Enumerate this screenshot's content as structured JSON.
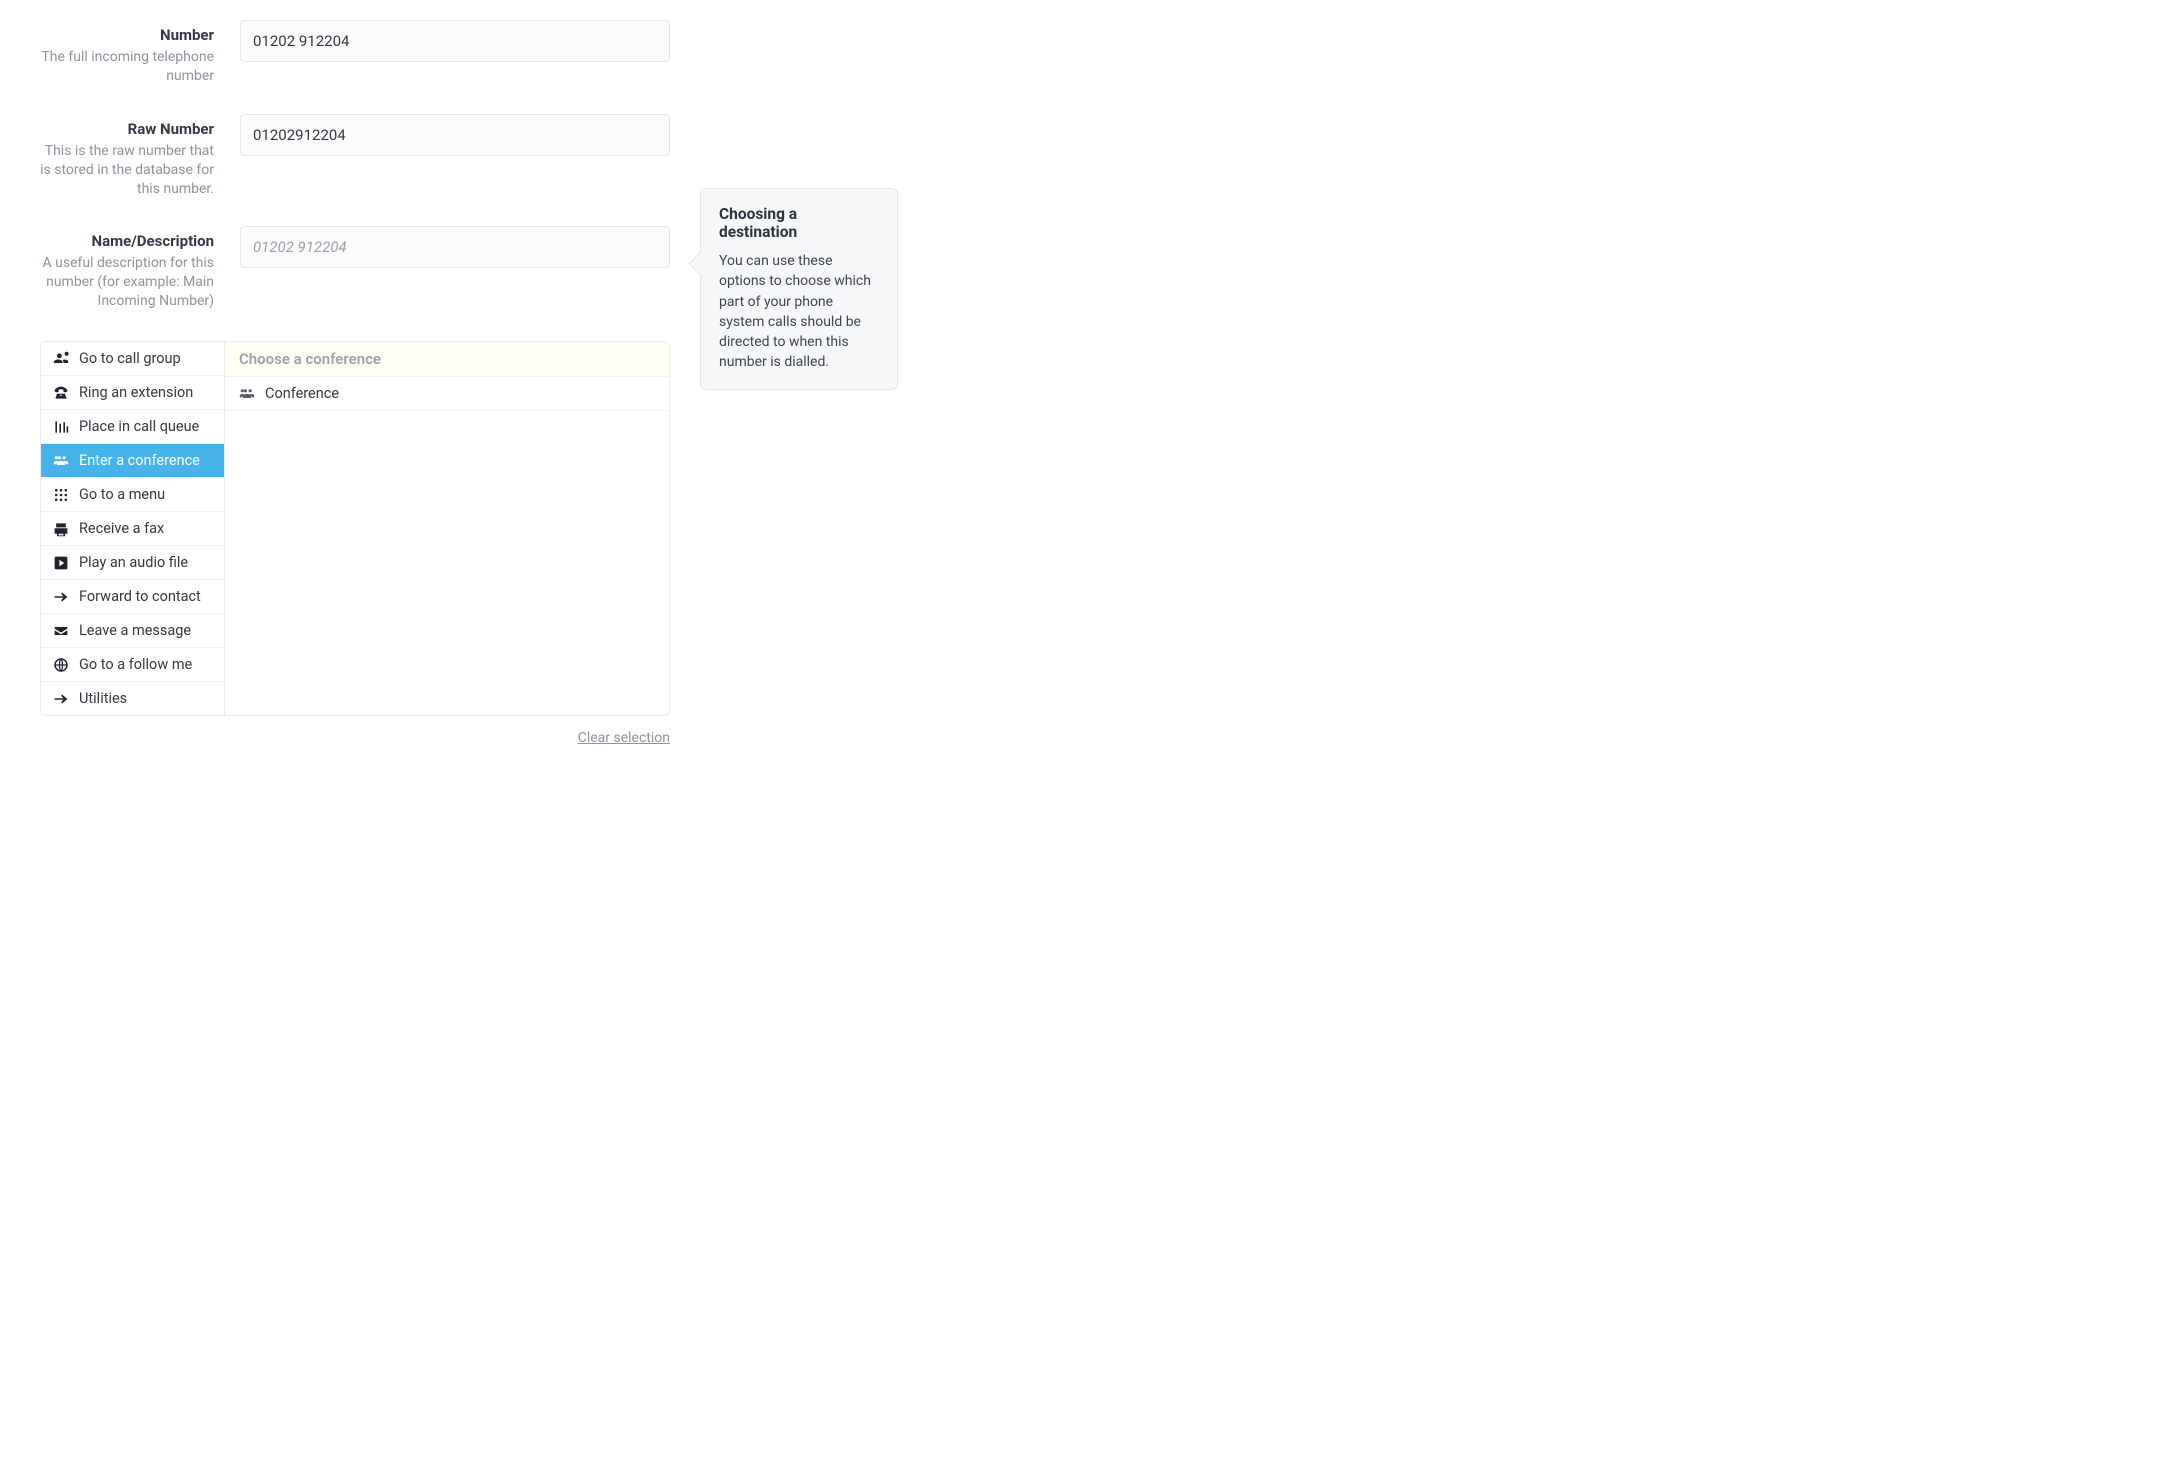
{
  "form": {
    "number": {
      "label": "Number",
      "hint": "The full incoming telephone number",
      "value": "01202 912204"
    },
    "raw_number": {
      "label": "Raw Number",
      "hint": "This is the raw number that is stored in the database for this number.",
      "value": "01202912204"
    },
    "name_desc": {
      "label": "Name/Description",
      "hint": "A useful description for this number (for example: Main Incoming Number)",
      "value": "",
      "placeholder": "01202 912204"
    }
  },
  "destinations": {
    "items": [
      {
        "icon": "users-icon",
        "label": "Go to call group"
      },
      {
        "icon": "phone-classic-icon",
        "label": "Ring an extension"
      },
      {
        "icon": "queue-icon",
        "label": "Place in call queue"
      },
      {
        "icon": "conference-icon",
        "label": "Enter a conference"
      },
      {
        "icon": "dialpad-icon",
        "label": "Go to a menu"
      },
      {
        "icon": "fax-icon",
        "label": "Receive a fax"
      },
      {
        "icon": "play-icon",
        "label": "Play an audio file"
      },
      {
        "icon": "arrow-right-icon",
        "label": "Forward to contact"
      },
      {
        "icon": "envelope-icon",
        "label": "Leave a message"
      },
      {
        "icon": "globe-icon",
        "label": "Go to a follow me"
      },
      {
        "icon": "arrow-right-icon",
        "label": "Utilities"
      }
    ],
    "active_index": 3,
    "detail_header": "Choose a conference",
    "detail_items": [
      {
        "icon": "conference-icon",
        "label": "Conference"
      }
    ]
  },
  "clear_label": "Clear selection",
  "info": {
    "title": "Choosing a destination",
    "body": "You can use these options to choose which part of your phone system calls should be directed to when this number is dialled."
  }
}
